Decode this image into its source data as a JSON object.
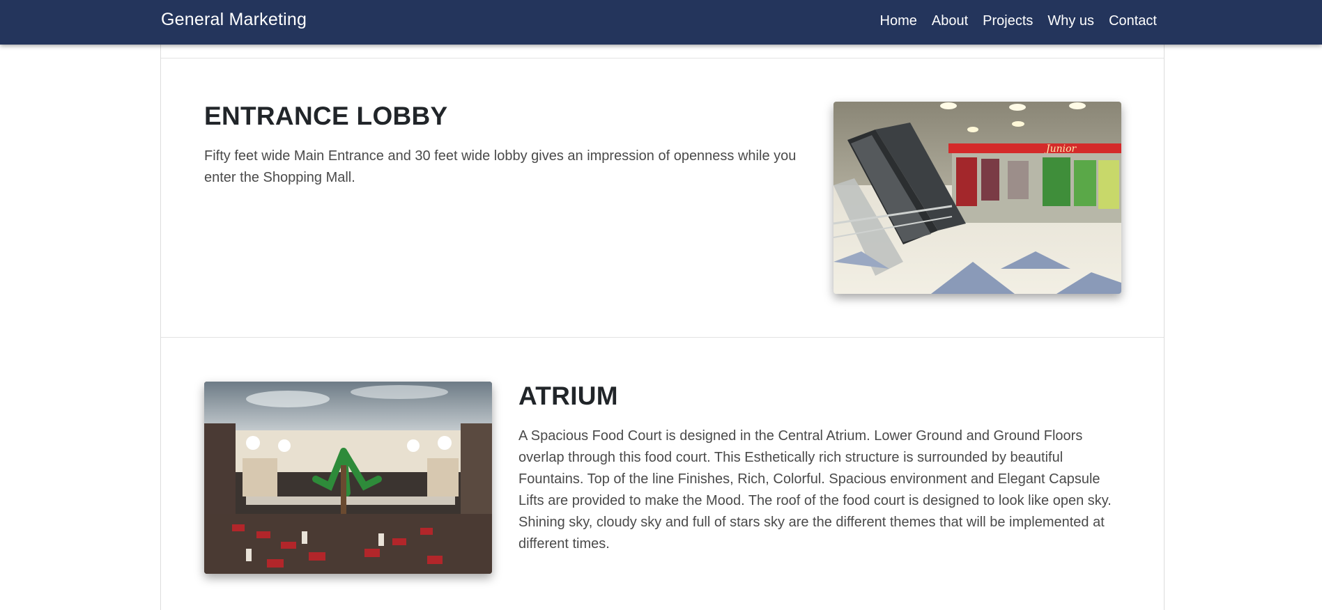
{
  "navbar": {
    "brand": "General Marketing",
    "links": [
      "Home",
      "About",
      "Projects",
      "Why us",
      "Contact"
    ],
    "background_color": "#24355c"
  },
  "sections": [
    {
      "title": "ENTRANCE LOBBY",
      "text": "Fifty feet wide Main Entrance and 30 feet wide lobby gives an impression of openness while you enter the Shopping Mall.",
      "image_icon": "escalator-mall-photo"
    },
    {
      "title": "ATRIUM",
      "text": "A Spacious Food Court is designed in the Central Atrium. Lower Ground and Ground Floors overlap through this food court. This Esthetically rich structure is surrounded by beautiful Fountains. Top of the line Finishes, Rich, Colorful. Spacious environment and Elegant Capsule Lifts are provided to make the Mood. The roof of the food court is designed to look like open sky. Shining sky, cloudy sky and full of stars sky are the different themes that will be implemented at different times.",
      "image_icon": "food-court-atrium-photo"
    }
  ]
}
